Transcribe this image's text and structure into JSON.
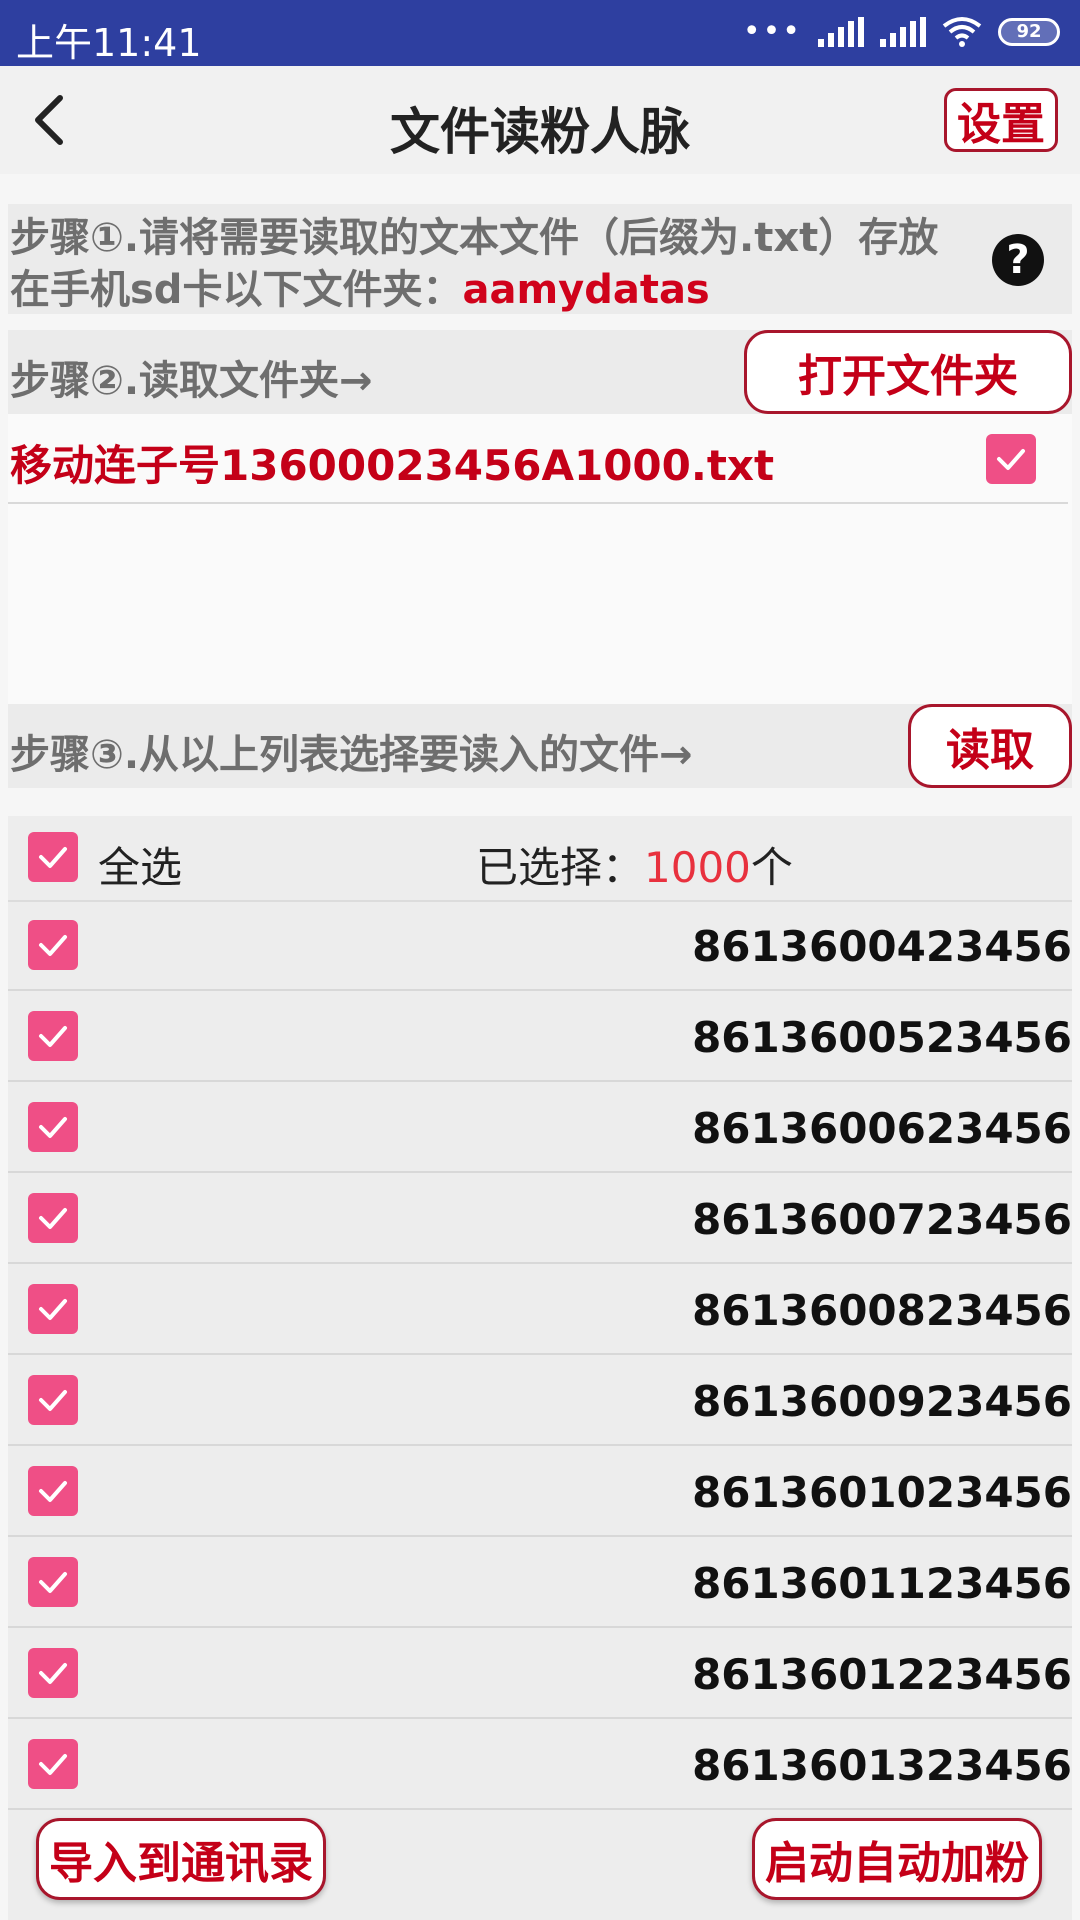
{
  "status_bar": {
    "time": "上午11:41",
    "battery": "92"
  },
  "header": {
    "title": "文件读粉人脉",
    "settings_label": "设置"
  },
  "step1": {
    "text": "步骤①.请将需要读取的文本文件（后缀为.txt）存放在手机sd卡以下文件夹：",
    "folder": "aamydatas",
    "help": "?"
  },
  "step2": {
    "text": "步骤②.读取文件夹→",
    "button": "打开文件夹"
  },
  "file_list": [
    {
      "name": "移动连子号13600023456A1000.txt",
      "checked": true
    }
  ],
  "step3": {
    "text": "步骤③.从以上列表选择要读入的文件→",
    "button": "读取"
  },
  "selection": {
    "select_all": "全选",
    "selected_prefix": "已选择：",
    "selected_count": "1000",
    "selected_suffix": "个"
  },
  "numbers": [
    "8613600423456",
    "8613600523456",
    "8613600623456",
    "8613600723456",
    "8613600823456",
    "8613600923456",
    "8613601023456",
    "8613601123456",
    "8613601223456",
    "8613601323456"
  ],
  "bottom": {
    "import": "导入到通讯录",
    "auto_add": "启动自动加粉"
  },
  "colors": {
    "accent": "#c40018",
    "checkbox": "#ef4f86",
    "statusbar": "#2e3fa0"
  }
}
